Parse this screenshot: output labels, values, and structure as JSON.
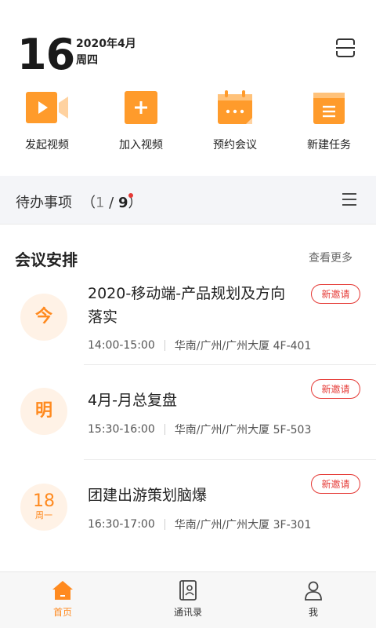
{
  "header": {
    "day": "16",
    "year_month": "2020年4月",
    "weekday": "周四",
    "scan_icon": "scan-frame-icon"
  },
  "actions": [
    {
      "label": "发起视频",
      "icon": "video-camera-icon"
    },
    {
      "label": "加入视频",
      "icon": "plus-square-icon"
    },
    {
      "label": "预约会议",
      "icon": "calendar-dots-icon"
    },
    {
      "label": "新建任务",
      "icon": "task-list-icon"
    }
  ],
  "todo": {
    "title": "待办事项",
    "open": "（",
    "current": "1",
    "slash": " / ",
    "total": "9",
    "close": "）",
    "menu_icon": "hamburger-menu-icon"
  },
  "meetings_section": {
    "title": "会议安排",
    "more": "查看更多",
    "items": [
      {
        "day": "今",
        "title": "2020-移动端-产品规划及方向落实",
        "time": "14:00-15:00",
        "location": "华南/广州/广州大厦 4F-401",
        "badge": "新邀请"
      },
      {
        "day": "明",
        "title": "4月-月总复盘",
        "time": "15:30-16:00",
        "location": "华南/广州/广州大厦 5F-503",
        "badge": "新邀请"
      },
      {
        "day_num": "18",
        "day_sub": "周一",
        "title": "团建出游策划脑爆",
        "time": "16:30-17:00",
        "location": "华南/广州/广州大厦 3F-301",
        "badge": "新邀请"
      }
    ]
  },
  "bottom_nav": [
    {
      "label": "首页",
      "icon": "home-icon",
      "active": true
    },
    {
      "label": "通讯录",
      "icon": "contacts-book-icon",
      "active": false
    },
    {
      "label": "我",
      "icon": "person-icon",
      "active": false
    }
  ],
  "colors": {
    "accent": "#ff8a1f",
    "badge_red": "#e53935",
    "todo_bg": "#f4f5f8"
  }
}
